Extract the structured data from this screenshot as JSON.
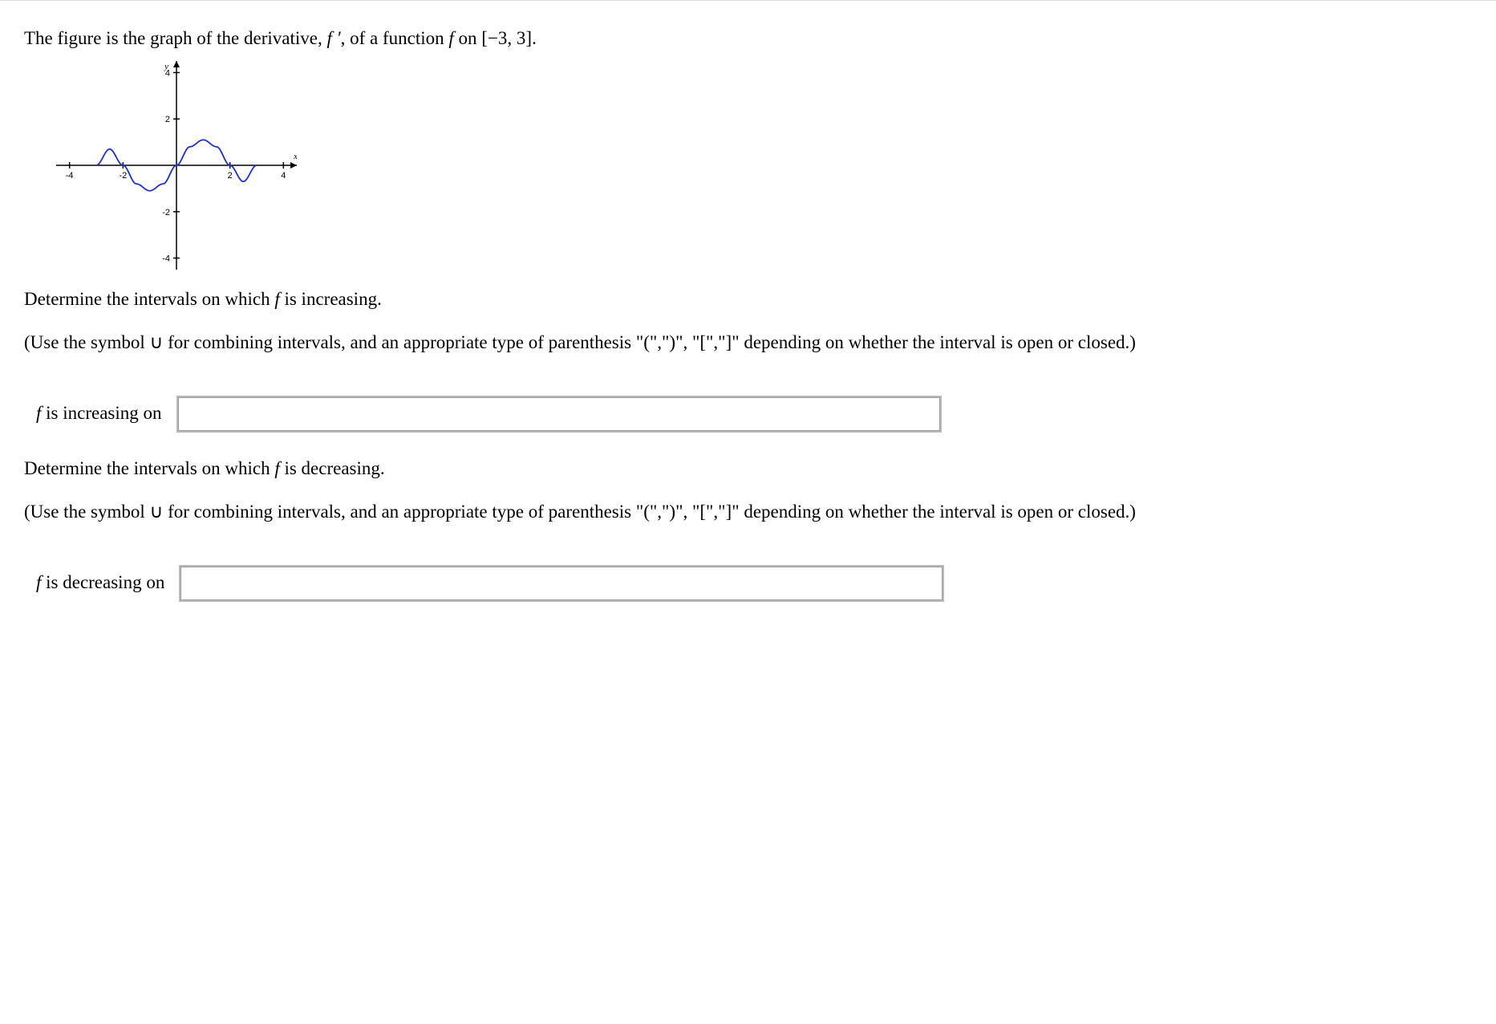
{
  "intro_prefix": "The figure is the graph of the derivative, ",
  "intro_fprime": "f ′",
  "intro_mid": ", of a function ",
  "intro_f": "f",
  "intro_suffix": " on [−3, 3].",
  "q1_prefix": "Determine the intervals on which ",
  "q1_f": "f",
  "q1_suffix": " is increasing.",
  "instructions": "(Use the symbol ∪ for combining intervals, and an appropriate type of parenthesis \"(\",\")\", \"[\",\"]\" depending on whether the interval is open or closed.)",
  "ans1_f": "f",
  "ans1_label": " is increasing on",
  "ans1_value": "",
  "q2_prefix": "Determine the intervals on which ",
  "q2_f": "f",
  "q2_suffix": " is decreasing.",
  "ans2_f": "f",
  "ans2_label": " is decreasing on",
  "ans2_value": "",
  "chart_data": {
    "type": "line",
    "title": "",
    "xlabel": "x",
    "ylabel": "y",
    "xlim": [
      -4.5,
      4.5
    ],
    "ylim": [
      -4.5,
      4.5
    ],
    "xticks": [
      -4,
      -2,
      2,
      4
    ],
    "yticks": [
      -4,
      -2,
      2,
      4
    ],
    "series": [
      {
        "name": "f'",
        "x": [
          -3,
          -2.5,
          -2,
          -1.5,
          -1,
          -0.5,
          0,
          0.5,
          1,
          1.5,
          2,
          2.5,
          3
        ],
        "y": [
          0,
          0.7,
          0,
          -0.8,
          -1.1,
          -0.8,
          0,
          0.8,
          1.1,
          0.8,
          0,
          -0.7,
          0
        ]
      }
    ]
  }
}
